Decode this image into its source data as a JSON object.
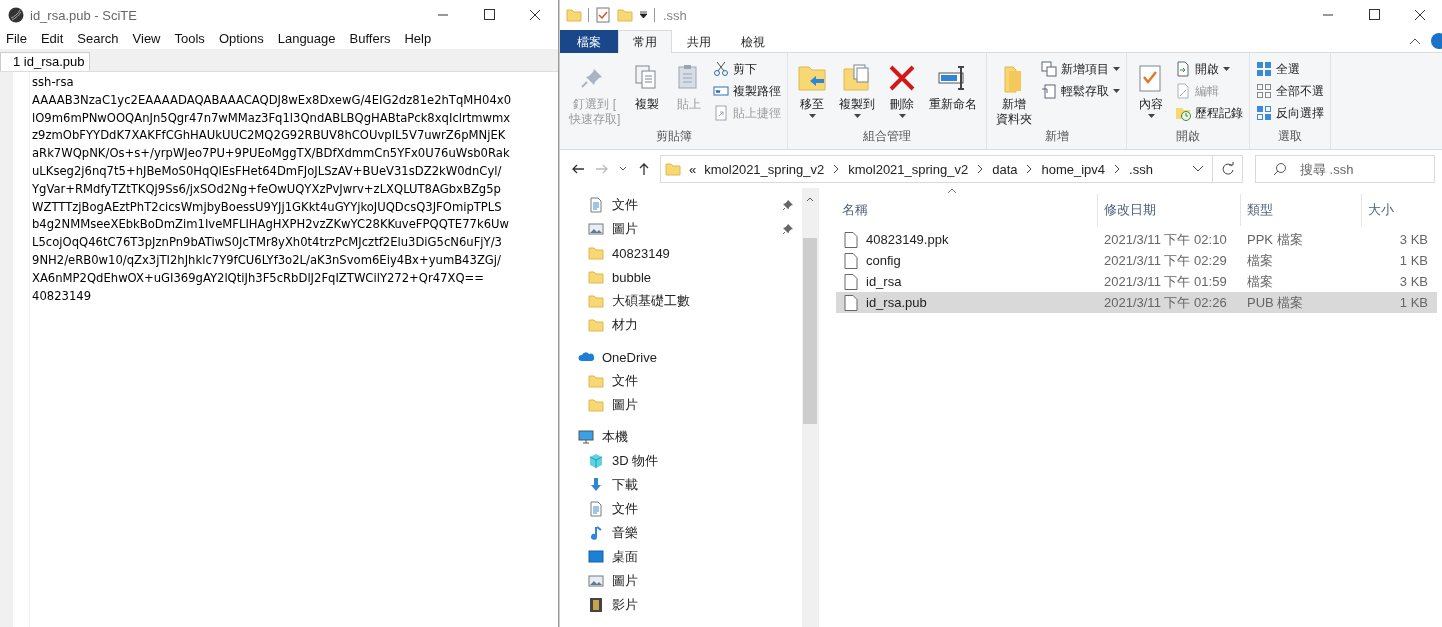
{
  "scite": {
    "window": {
      "title": "id_rsa.pub - SciTE"
    },
    "menu": [
      "File",
      "Edit",
      "Search",
      "View",
      "Tools",
      "Options",
      "Language",
      "Buffers",
      "Help"
    ],
    "tabs": [
      {
        "label": "1 id_rsa.pub",
        "selected": true
      }
    ],
    "editor_lines": [
      "ssh-rsa",
      "AAAAB3NzaC1yc2EAAAADAQABAAACAQDJ8wEx8DxewG/4EIG2dz81e2hTqMH04x0",
      "lO9m6mPNwOOQAnJn5Qgr47n7wMMaz3Fq1l3QndABLBQgHABtaPck8xqIclrtmwmx",
      "z9zmObFYYDdK7XAKFfCGhHAUkUUC2MQ2G92RBUV8hCOUvpIL5V7uwrZ6pMNjEK",
      "aRk7WQpNK/Os+s+/yrpWJeo7PU+9PUEoMggTX/BDfXdmmCn5YFx0U76uWsb0Rak",
      "uLKseg2j6nq7t5+hJBeMoS0HqQlEsFHet64DmFJoJLSzAV+BUeV31sDZ2kW0dnCyl/",
      "YgVar+RMdfyTZtTKQj9Ss6/jxSOd2Ng+feOwUQYXzPvJwrv+zLXQLUT8AGbxBZg5p",
      "WZTTTzjBogAEztPhT2cicsWmjbyBoessU9YJj1GKkt4uGYYjkoJUQDcsQ3JFOmipTPLS",
      "b4g2NMMseeXEbkBoDmZim1IveMFLIHAgHXPH2vzZKwYC28KKuveFPQQTE77k6Uw",
      "L5cojOqQ46tC76T3pJznPn9bATiwS0JcTMr8yXh0t4trzPcMJcztf2Elu3DiG5cN6uFjY/3",
      "9NH2/eRB0w10/qZx3jTI2hJhklc7Y9fCU6LYf3o2L/aK3nSvom6Eiy4Bx+yumB43ZGj/",
      "XA6nMP2QdEhwOX+uGI369gAY2lQtiJh3F5cRbDlJ2FqIZTWCilY272+Qr47XQ==",
      "40823149"
    ]
  },
  "explorer": {
    "window": {
      "title": ".ssh"
    },
    "ribbon_tabs": [
      {
        "label": "檔案",
        "kind": "file",
        "selected": false
      },
      {
        "label": "常用",
        "kind": "tab",
        "selected": true
      },
      {
        "label": "共用",
        "kind": "tab",
        "selected": false
      },
      {
        "label": "檢視",
        "kind": "tab",
        "selected": false
      }
    ],
    "ribbon_groups": [
      {
        "label": "剪貼簿",
        "items": [
          {
            "kind": "large",
            "label_lines": [
              "釘選到 [",
              "快速存取]"
            ],
            "disabled": true,
            "dropdown": false
          },
          {
            "kind": "large",
            "label_lines": [
              "複製"
            ],
            "disabled": false,
            "dropdown": false
          },
          {
            "kind": "large",
            "label_lines": [
              "貼上"
            ],
            "disabled": true,
            "dropdown": false
          },
          {
            "kind": "small",
            "label": "剪下",
            "disabled": false,
            "dropdown": false
          },
          {
            "kind": "small",
            "label": "複製路徑",
            "disabled": false,
            "dropdown": false
          },
          {
            "kind": "small",
            "label": "貼上捷徑",
            "disabled": true,
            "dropdown": false
          }
        ]
      },
      {
        "label": "組合管理",
        "items": [
          {
            "kind": "large",
            "label_lines": [
              "移至"
            ],
            "disabled": false,
            "dropdown": true
          },
          {
            "kind": "large",
            "label_lines": [
              "複製到"
            ],
            "disabled": false,
            "dropdown": true
          },
          {
            "kind": "large",
            "label_lines": [
              "刪除"
            ],
            "disabled": false,
            "dropdown": true
          },
          {
            "kind": "large",
            "label_lines": [
              "重新命名"
            ],
            "disabled": false,
            "dropdown": false
          }
        ]
      },
      {
        "label": "新增",
        "items": [
          {
            "kind": "large",
            "label_lines": [
              "新增",
              "資料夾"
            ],
            "disabled": false,
            "dropdown": false
          },
          {
            "kind": "small",
            "label": "新增項目",
            "disabled": false,
            "dropdown": true
          },
          {
            "kind": "small",
            "label": "輕鬆存取",
            "disabled": false,
            "dropdown": true
          }
        ]
      },
      {
        "label": "開啟",
        "items": [
          {
            "kind": "large",
            "label_lines": [
              "內容"
            ],
            "disabled": false,
            "dropdown": true
          },
          {
            "kind": "small",
            "label": "開啟",
            "disabled": false,
            "dropdown": true
          },
          {
            "kind": "small",
            "label": "編輯",
            "disabled": true,
            "dropdown": false
          },
          {
            "kind": "small",
            "label": "歷程記錄",
            "disabled": false,
            "dropdown": false
          }
        ]
      },
      {
        "label": "選取",
        "items": [
          {
            "kind": "small",
            "label": "全選",
            "disabled": false,
            "dropdown": false
          },
          {
            "kind": "small",
            "label": "全部不選",
            "disabled": false,
            "dropdown": false
          },
          {
            "kind": "small",
            "label": "反向選擇",
            "disabled": false,
            "dropdown": false
          }
        ]
      }
    ],
    "breadcrumb": [
      "«",
      "kmol2021_spring_v2",
      "kmol2021_spring_v2",
      "data",
      "home_ipv4",
      ".ssh"
    ],
    "search": {
      "placeholder": "搜尋 .ssh"
    },
    "nav_pane": {
      "quick_access": [
        {
          "label": "文件",
          "kind": "document",
          "pinned": true
        },
        {
          "label": "圖片",
          "kind": "pictures",
          "pinned": true
        },
        {
          "label": "40823149",
          "kind": "folder",
          "pinned": false
        },
        {
          "label": "bubble",
          "kind": "folder",
          "pinned": false
        },
        {
          "label": "大碩基礎工數",
          "kind": "folder",
          "pinned": false
        },
        {
          "label": "材力",
          "kind": "folder",
          "pinned": false
        }
      ],
      "tree": [
        {
          "label": "OneDrive",
          "kind": "cloud",
          "children": [
            {
              "label": "文件",
              "kind": "folder"
            },
            {
              "label": "圖片",
              "kind": "folder"
            }
          ]
        },
        {
          "label": "本機",
          "kind": "pc",
          "children": [
            {
              "label": "3D 物件",
              "kind": "cube"
            },
            {
              "label": "下載",
              "kind": "download"
            },
            {
              "label": "文件",
              "kind": "document"
            },
            {
              "label": "音樂",
              "kind": "music"
            },
            {
              "label": "桌面",
              "kind": "desktop"
            },
            {
              "label": "圖片",
              "kind": "pictures"
            },
            {
              "label": "影片",
              "kind": "video"
            }
          ]
        }
      ]
    },
    "file_list": {
      "columns": [
        "名稱",
        "修改日期",
        "類型",
        "大小"
      ],
      "rows": [
        {
          "name": "40823149.ppk",
          "modified": "2021/3/11 下午 02:10",
          "type": "PPK 檔案",
          "size": "3 KB",
          "selected": false
        },
        {
          "name": "config",
          "modified": "2021/3/11 下午 02:29",
          "type": "檔案",
          "size": "1 KB",
          "selected": false
        },
        {
          "name": "id_rsa",
          "modified": "2021/3/11 下午 01:59",
          "type": "檔案",
          "size": "3 KB",
          "selected": false
        },
        {
          "name": "id_rsa.pub",
          "modified": "2021/3/11 下午 02:26",
          "type": "PUB 檔案",
          "size": "1 KB",
          "selected": true
        }
      ]
    }
  }
}
